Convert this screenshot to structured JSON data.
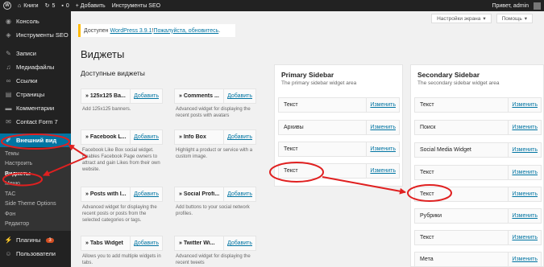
{
  "adminbar": {
    "logo": "W",
    "site_name": "Книги",
    "updates_count": "5",
    "comments_count": "0",
    "new_label": "+ Добавить",
    "seo_label": "Инструменты SEO",
    "greeting": "Привет, admin"
  },
  "sidebar": {
    "items": [
      {
        "label": "Консоль",
        "icon": "dashboard-icon"
      },
      {
        "label": "Инструменты SEO",
        "icon": "seo-icon"
      },
      {
        "label": "Записи",
        "icon": "pin-icon"
      },
      {
        "label": "Медиафайлы",
        "icon": "media-icon"
      },
      {
        "label": "Ссылки",
        "icon": "link-icon"
      },
      {
        "label": "Страницы",
        "icon": "page-icon"
      },
      {
        "label": "Комментарии",
        "icon": "comment-icon"
      },
      {
        "label": "Contact Form 7",
        "icon": "mail-icon"
      },
      {
        "label": "Внешний вид",
        "icon": "brush-icon"
      }
    ],
    "submenu": [
      "Темы",
      "Настроить",
      "Виджеты",
      "Меню",
      "TAC",
      "Side Theme Options",
      "Фон",
      "Редактор"
    ],
    "plugins_label": "Плагины",
    "plugins_badge": "3",
    "users_label": "Пользователи"
  },
  "top_buttons": {
    "screen_options": "Настройки экрана",
    "help": "Помощь"
  },
  "notice": {
    "prefix": "Доступен ",
    "version_link": "WordPress 3.9.1",
    "separator": "! ",
    "update_link": "Пожалуйста, обновитесь",
    "suffix": "."
  },
  "page_title": "Виджеты",
  "available_title": "Доступные виджеты",
  "add_label": "Добавить",
  "available_widgets": [
    {
      "title": "» 125x125 Ba...",
      "desc": "Add 125x125 banners."
    },
    {
      "title": "» Comments ...",
      "desc": "Advanced widget for displaying the recent posts with avatars"
    },
    {
      "title": "» Facebook L...",
      "desc": "Facebook Like Box social widget. Enables Facebook Page owners to attract and gain Likes from their own website."
    },
    {
      "title": "» Info Box",
      "desc": "Highlight a product or service with a custom image."
    },
    {
      "title": "» Posts with I...",
      "desc": "Advanced widget for displaying the recent posts or posts from the selected categories or tags."
    },
    {
      "title": "» Social Profi...",
      "desc": "Add buttons to your social network profiles."
    },
    {
      "title": "» Tabs Widget",
      "desc": "Allows you to add multiple widgets in tabs."
    },
    {
      "title": "» Twitter Wi...",
      "desc": "Advanced widget for displaying the recent tweets"
    }
  ],
  "edit_label": "Изменить",
  "primary": {
    "title": "Primary Sidebar",
    "desc": "The primary sidebar widget area",
    "widgets": [
      "Текст",
      "Архивы",
      "Текст",
      "Текст"
    ]
  },
  "secondary": {
    "title": "Secondary Sidebar",
    "desc": "The secondary sidebar widget area",
    "widgets": [
      "Текст",
      "Поиск",
      "Social Media Widget",
      "Текст",
      "Текст",
      "Рубрики",
      "Текст",
      "Мета"
    ]
  },
  "colors": {
    "accent": "#0074a2",
    "annotation": "#e02020"
  }
}
